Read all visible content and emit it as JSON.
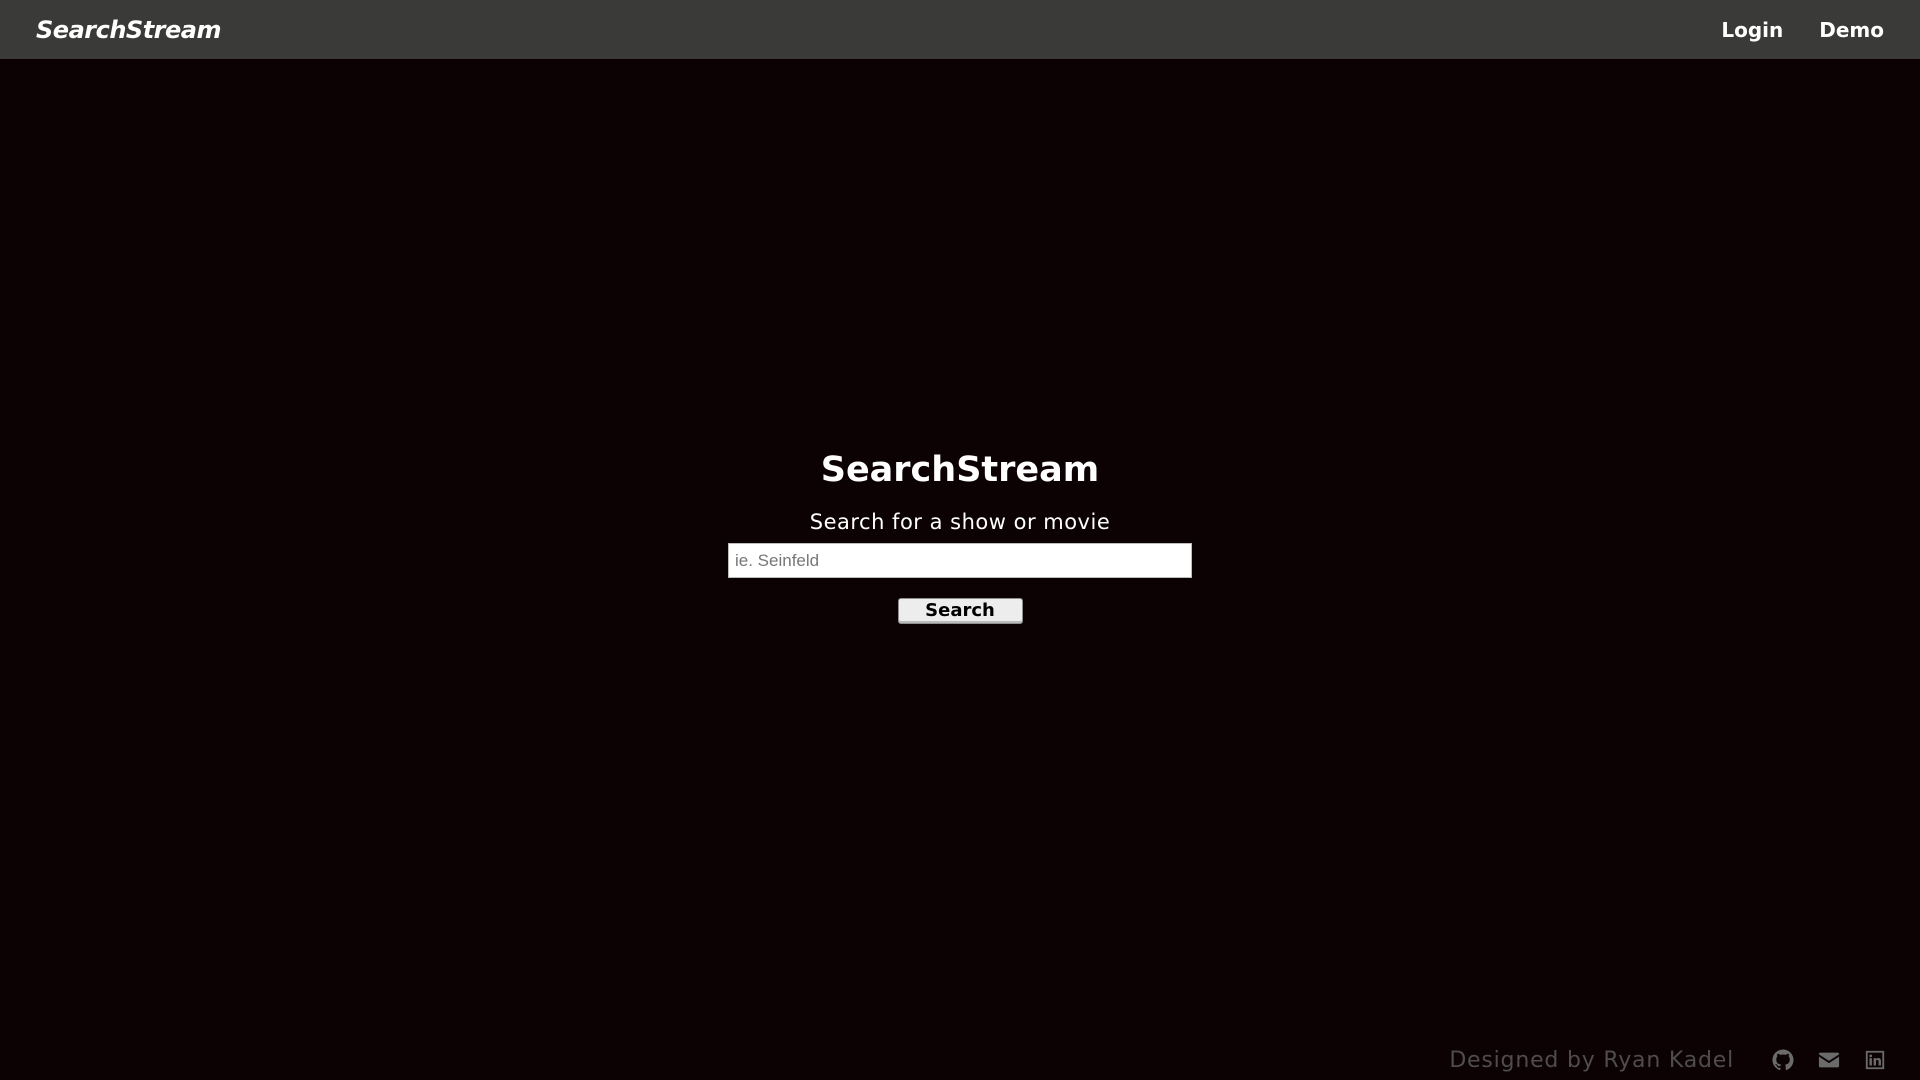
{
  "navbar": {
    "brand": "SearchStream",
    "links": [
      {
        "label": "Login"
      },
      {
        "label": "Demo"
      }
    ]
  },
  "hero": {
    "title": "SearchStream",
    "subtitle": "Search for a show or movie",
    "search_input": {
      "value": "",
      "placeholder": "ie. Seinfeld"
    },
    "search_button": "Search"
  },
  "footer": {
    "credit": "Designed by Ryan Kadel",
    "icons": [
      "github-icon",
      "envelope-icon",
      "linkedin-icon"
    ]
  },
  "colors": {
    "navbar_bg": "#3a3b38",
    "page_bg": "#0c0204",
    "text": "#ffffff",
    "footer_text": "#4f4c4d"
  }
}
